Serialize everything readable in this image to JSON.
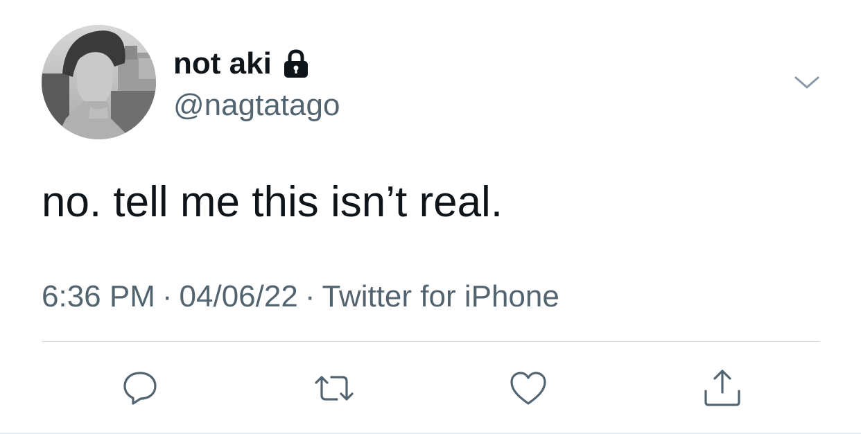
{
  "tweet": {
    "display_name": "not aki",
    "handle": "@nagtatago",
    "text": "no. tell me this isn’t real.",
    "time": "6:36 PM",
    "date": "04/06/22",
    "source": "Twitter for iPhone",
    "separator": "·"
  },
  "icons": {
    "lock": "lock-icon",
    "caret": "chevron-down-icon",
    "reply": "reply-icon",
    "retweet": "retweet-icon",
    "like": "heart-icon",
    "share": "share-icon"
  },
  "colors": {
    "text": "#0f1419",
    "secondary": "#536471",
    "divider": "#cfd9de"
  }
}
